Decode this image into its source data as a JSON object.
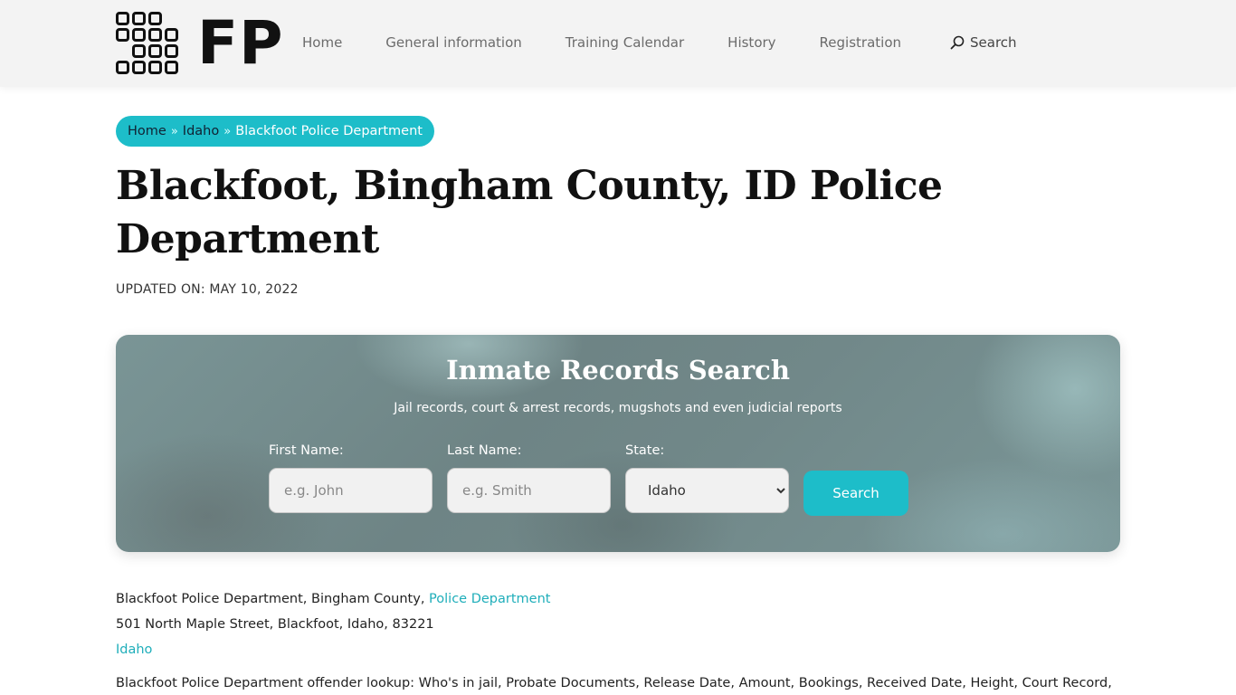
{
  "header": {
    "logo_text": "FP",
    "nav": [
      {
        "label": "Home"
      },
      {
        "label": "General information"
      },
      {
        "label": "Training Calendar"
      },
      {
        "label": "History"
      },
      {
        "label": "Registration"
      }
    ],
    "search_label": "Search"
  },
  "breadcrumb": {
    "home": "Home",
    "state": "Idaho",
    "current": "Blackfoot Police Department",
    "separator": "»"
  },
  "page": {
    "title": "Blackfoot, Bingham County, ID Police Department",
    "updated": "UPDATED ON: MAY 10, 2022"
  },
  "search_panel": {
    "title": "Inmate Records Search",
    "subtitle": "Jail records, court & arrest records, mugshots and even judicial reports",
    "first_name_label": "First Name:",
    "first_name_placeholder": "e.g. John",
    "last_name_label": "Last Name:",
    "last_name_placeholder": "e.g. Smith",
    "state_label": "State:",
    "state_value": "Idaho",
    "button_label": "Search"
  },
  "info": {
    "line1_text": "Blackfoot Police Department, Bingham County, ",
    "line1_link": "Police Department",
    "address": "501 North Maple Street, Blackfoot, Idaho, 83221",
    "state_link": "Idaho"
  },
  "description": "Blackfoot Police Department offender lookup: Who's in jail, Probate Documents, Release Date, Amount, Bookings, Received Date, Height, Court Record,",
  "colors": {
    "accent": "#1dbdc9",
    "link": "#1faeba",
    "header_bg": "#f3f3f3"
  }
}
